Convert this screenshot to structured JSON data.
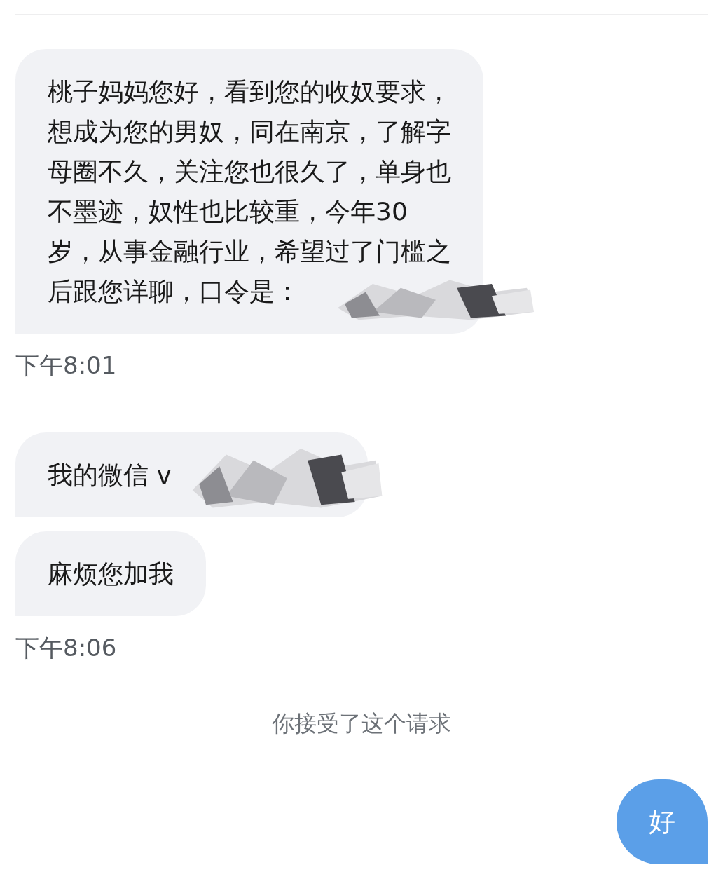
{
  "messages": [
    {
      "kind": "received",
      "lines": [
        "桃子妈妈您好，看到您的收奴要求，",
        "想成为您的男奴，同在南京，了解字",
        "母圈不久，关注您也很久了，单身也",
        "不墨迹，奴性也比较重，今年30",
        "岁，从事金融行业，希望过了门槛之",
        "后跟您详聊，口令是："
      ],
      "redacted": true
    },
    {
      "kind": "time",
      "text": "下午8:01"
    },
    {
      "kind": "received",
      "lines": [
        "我的微信 v"
      ],
      "redacted": true
    },
    {
      "kind": "received",
      "lines": [
        "麻烦您加我"
      ],
      "redacted": false
    },
    {
      "kind": "time",
      "text": "下午8:06"
    },
    {
      "kind": "system",
      "text": "你接受了这个请求"
    },
    {
      "kind": "sent",
      "lines": [
        "好"
      ],
      "redacted": false
    }
  ]
}
